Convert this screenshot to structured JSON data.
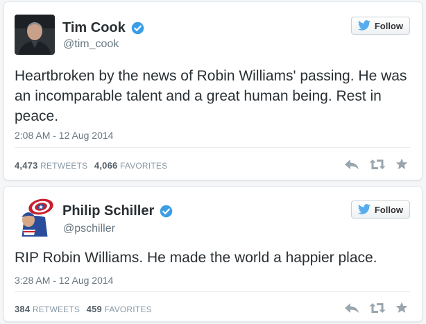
{
  "colors": {
    "verified": "#3a9ee6",
    "twitter_blue": "#55acee",
    "action_icon": "#9aa5ad"
  },
  "follow_label": "Follow",
  "tweets": [
    {
      "name": "Tim Cook",
      "handle": "@tim_cook",
      "text": "Heartbroken by the news of Robin Williams' passing. He was an incomparable talent and a great human being. Rest in peace.",
      "timestamp": "2:08 AM - 12 Aug 2014",
      "retweets": "4,473",
      "retweets_label": "RETWEETS",
      "favorites": "4,066",
      "favorites_label": "FAVORITES"
    },
    {
      "name": "Philip Schiller",
      "handle": "@pschiller",
      "text": "RIP Robin Williams. He made the world a happier place.",
      "timestamp": "3:28 AM - 12 Aug 2014",
      "retweets": "384",
      "retweets_label": "RETWEETS",
      "favorites": "459",
      "favorites_label": "FAVORITES"
    }
  ],
  "icons": [
    "verified-badge-icon",
    "twitter-bird-icon",
    "reply-icon",
    "retweet-icon",
    "favorite-star-icon"
  ]
}
